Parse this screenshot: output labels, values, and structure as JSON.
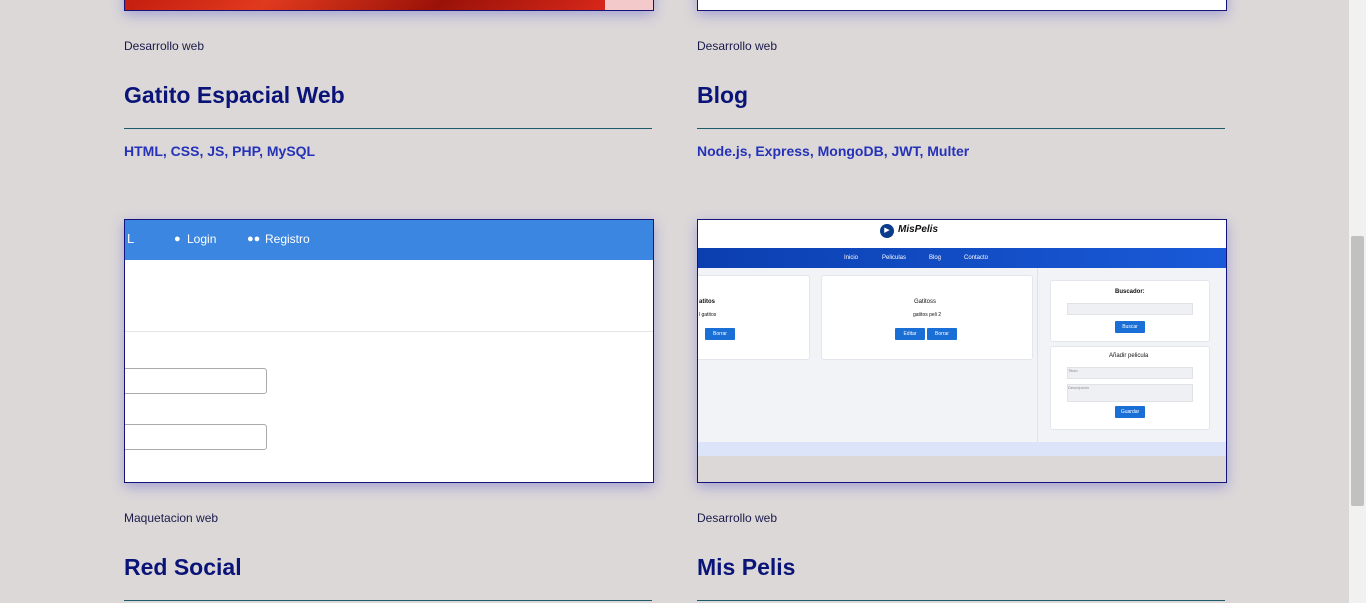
{
  "cards": [
    {
      "category": "Desarrollo web",
      "title": "Gatito Espacial Web",
      "tech": "HTML, CSS, JS, PHP, MySQL"
    },
    {
      "category": "Desarrollo web",
      "title": "Blog",
      "tech": "Node.js, Express, MongoDB, JWT, Multer"
    },
    {
      "category": "Maquetacion web",
      "title": "Red Social"
    },
    {
      "category": "Desarrollo web",
      "title": "Mis Pelis"
    }
  ],
  "red_social_thumb": {
    "brand_fragment": "L",
    "login": "Login",
    "register": "Registro"
  },
  "mis_pelis_thumb": {
    "brand": "MisPelis",
    "nav": [
      "Inicio",
      "Peliculas",
      "Blog",
      "Contacto"
    ],
    "card_left_title": "atitos",
    "card_left_sub": "l gatitos",
    "card_left_delete": "Borrar",
    "card_title": "Gatitoss",
    "card_sub": "gatitos peli 2",
    "edit": "Editar",
    "delete": "Borrar",
    "search_title": "Buscador:",
    "search_btn": "Buscar",
    "add_title": "Añadir pelicula",
    "title_placeholder": "Titulo",
    "desc_placeholder": "Descripción",
    "save_btn": "Guardar"
  },
  "colors": {
    "background": "#dcd8d8",
    "title": "#0a1478",
    "tech": "#2532b8",
    "rule": "#1f5a6a"
  }
}
